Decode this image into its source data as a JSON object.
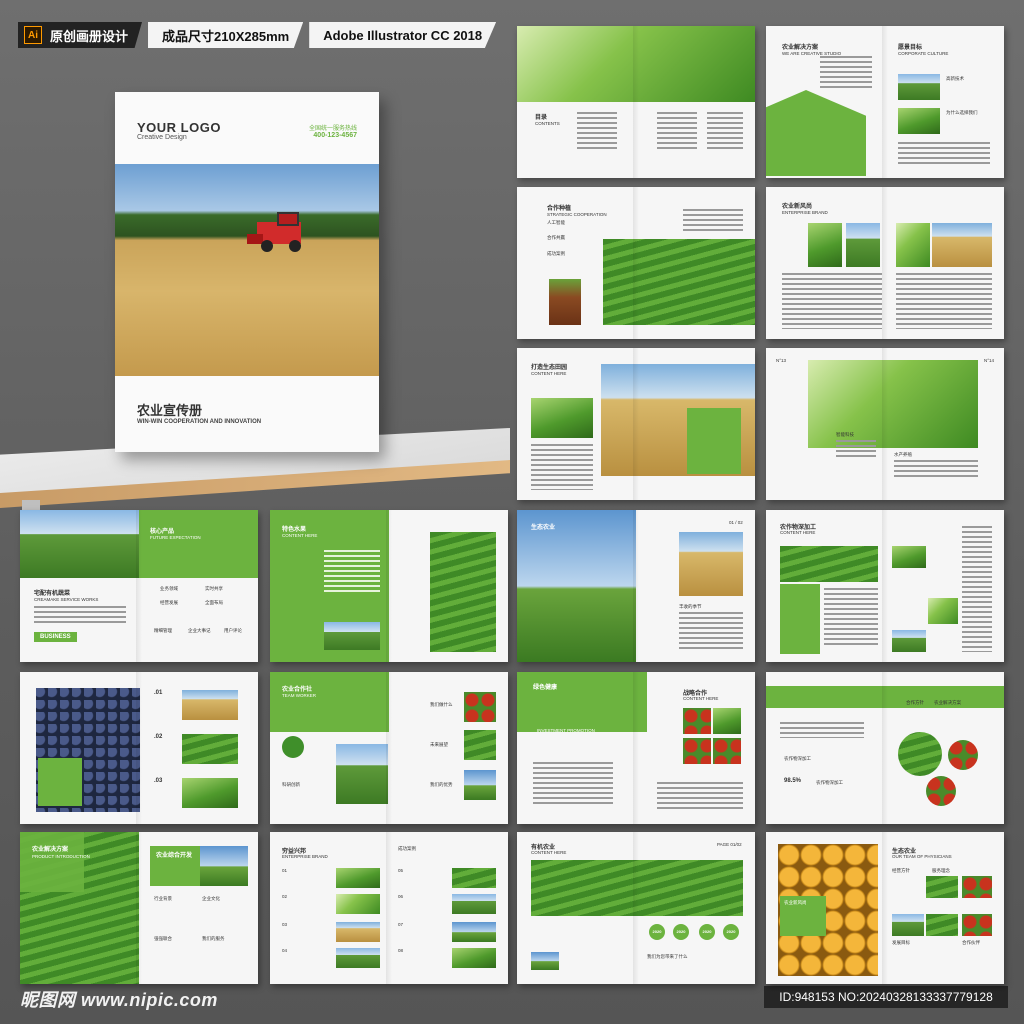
{
  "banner": {
    "ai_icon": "Ai",
    "original": "原创画册设计",
    "size": "成品尺寸210X285mm",
    "software": "Adobe Illustrator CC 2018"
  },
  "cover": {
    "logo": "YOUR LOGO",
    "logo_sub": "Creative Design",
    "hotline_label": "全国统一服务热线",
    "hotline": "400-123-4567",
    "title": "农业宣传册",
    "subtitle": "WIN-WIN COOPERATION AND INNOVATION"
  },
  "spreads": {
    "s1": {
      "title": "目录",
      "sub": "CONTENTS"
    },
    "s2": {
      "title": "农业解决方案",
      "sub": "WE ARE CREATIVE STUDIO",
      "right_title": "愿景目标",
      "right_sub": "CORPORATE CULTURE",
      "item1": "高新技术",
      "item2": "为什么选择我们"
    },
    "s3": {
      "title": "合作种植",
      "sub": "STRATEGIC COOPERATION",
      "item1": "人工智能",
      "item2": "合作共赢",
      "item3": "成功案例"
    },
    "s4": {
      "title": "农业新风尚",
      "sub": "ENTERPRISE BRAND"
    },
    "s5": {
      "title": "打造生态田园",
      "sub": "CONTENT HERE"
    },
    "s6": {
      "left_num": "N°13",
      "right_num": "N°14",
      "item1": "智能科技",
      "item2": "水产养殖"
    },
    "s7": {
      "title": "宅配有机蔬菜",
      "sub": "CREAMAKE SERVICE WORKS",
      "right_title": "核心产品",
      "right_sub": "FUTURE EXPECTATION",
      "b1": "业务领域",
      "b2": "实时共享",
      "b3": "经营发展",
      "b4": "全面布局",
      "b5": "精细管理",
      "b6": "企业大事记",
      "b7": "用户评论",
      "badge": "BUSINESS"
    },
    "s8": {
      "title": "特色水果",
      "sub": "CONTENT HERE"
    },
    "s9": {
      "title": "生态农业",
      "page": "01 / 02",
      "item": "丰收的季节"
    },
    "s10": {
      "title": "农作物深加工",
      "sub": "CONTENT HERE"
    },
    "s11": {
      "n1": ".01",
      "n2": ".02",
      "n3": ".03"
    },
    "s12": {
      "title": "农业合作社",
      "sub": "TEAM WORKER",
      "item1": "科研创新",
      "item2": "我们做什么",
      "item3": "未来展望",
      "item4": "我们的优势"
    },
    "s13": {
      "title": "绿色健康",
      "sub": "INVESTMENT PROMOTION",
      "right_title": "战略合作",
      "right_sub": "CONTENT HERE"
    },
    "s14": {
      "title": "农作物深加工",
      "stat": "98.5%",
      "stat_label": "农作物深加工",
      "item1": "合作方针",
      "item2": "农业解决方案"
    },
    "s15": {
      "title": "农业解决方案",
      "sub": "PRODUCT INTRODUCTION",
      "right_title": "农业综合开发",
      "item1": "行业背景",
      "item2": "企业文化",
      "item3": "强强联合",
      "item4": "我们的服务"
    },
    "s16": {
      "title": "穷益兴邦",
      "sub": "ENTERPRISE BRAND",
      "right_title": "成功案例",
      "n1": "01",
      "n2": "02",
      "n3": "03",
      "n4": "04",
      "n5": "05",
      "n6": "06",
      "n7": "07",
      "n8": "08"
    },
    "s17": {
      "title": "有机农业",
      "sub": "CONTENT HERE",
      "page": "PAGE 01/02",
      "y1": "2020",
      "y2": "2020",
      "y3": "2020",
      "y4": "2020",
      "q": "我们为您带来了什么"
    },
    "s18": {
      "title": "生态农业",
      "sub": "OUR TEAM OF PHYSICIANS",
      "badge": "农业新风尚",
      "item1": "经营方针",
      "item2": "服务理念",
      "item3": "发展目标",
      "item4": "合作伙伴"
    }
  },
  "footer": {
    "left": "昵图网 www.nipic.com",
    "right": "ID:948153 NO:20240328133337779128"
  },
  "colors": {
    "accent": "#6cb33f",
    "accent_dark": "#3f8f2a",
    "background": "#6a6a6a"
  }
}
